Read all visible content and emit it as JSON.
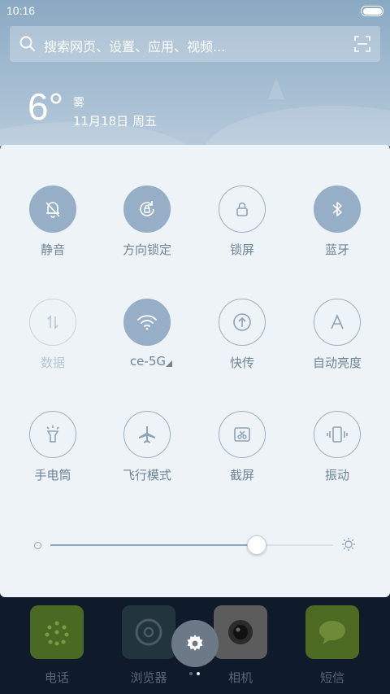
{
  "status_bar": {
    "time": "10:16"
  },
  "search": {
    "placeholder": "搜索网页、设置、应用、视频..."
  },
  "weather": {
    "temperature": "6°",
    "condition": "雾",
    "date": "11月18日 周五"
  },
  "toggles": [
    {
      "label": "静音",
      "icon": "bell-off-icon",
      "state": "on"
    },
    {
      "label": "方向锁定",
      "icon": "rotation-lock-icon",
      "state": "on"
    },
    {
      "label": "锁屏",
      "icon": "lock-icon",
      "state": "off"
    },
    {
      "label": "蓝牙",
      "icon": "bluetooth-icon",
      "state": "on"
    },
    {
      "label": "数据",
      "icon": "mobile-data-icon",
      "state": "disabled"
    },
    {
      "label": "ce-5G",
      "icon": "wifi-icon",
      "state": "on"
    },
    {
      "label": "快传",
      "icon": "upload-icon",
      "state": "off"
    },
    {
      "label": "自动亮度",
      "icon": "auto-brightness-icon",
      "state": "off"
    },
    {
      "label": "手电筒",
      "icon": "flashlight-icon",
      "state": "off"
    },
    {
      "label": "飞行模式",
      "icon": "airplane-icon",
      "state": "off"
    },
    {
      "label": "截屏",
      "icon": "screenshot-icon",
      "state": "off"
    },
    {
      "label": "振动",
      "icon": "vibrate-icon",
      "state": "off"
    }
  ],
  "brightness": {
    "level": 0.73
  },
  "dock": {
    "apps": [
      {
        "label": "电话",
        "icon": "phone-icon",
        "color": "#4a6a24"
      },
      {
        "label": "浏览器",
        "icon": "browser-icon",
        "color": "#22353e"
      },
      {
        "label": "相机",
        "icon": "camera-icon",
        "color": "#5c5c5c"
      },
      {
        "label": "短信",
        "icon": "message-icon",
        "color": "#4c6a22"
      }
    ]
  },
  "colors": {
    "accent": "#97afc6",
    "panel": "#edf3f7",
    "label": "#6f8496"
  }
}
